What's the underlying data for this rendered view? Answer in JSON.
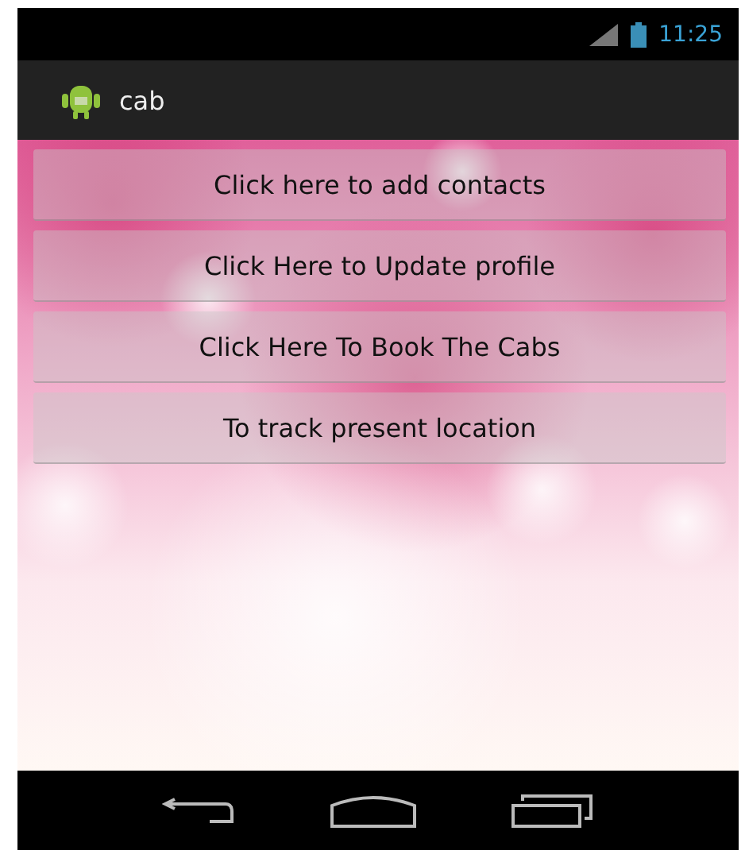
{
  "status_bar": {
    "time": "11:25"
  },
  "action_bar": {
    "title": "cab"
  },
  "buttons": [
    {
      "label": "Click here to add contacts"
    },
    {
      "label": "Click Here to Update profile"
    },
    {
      "label": "Click Here To Book The Cabs"
    },
    {
      "label": "To track present location"
    }
  ]
}
